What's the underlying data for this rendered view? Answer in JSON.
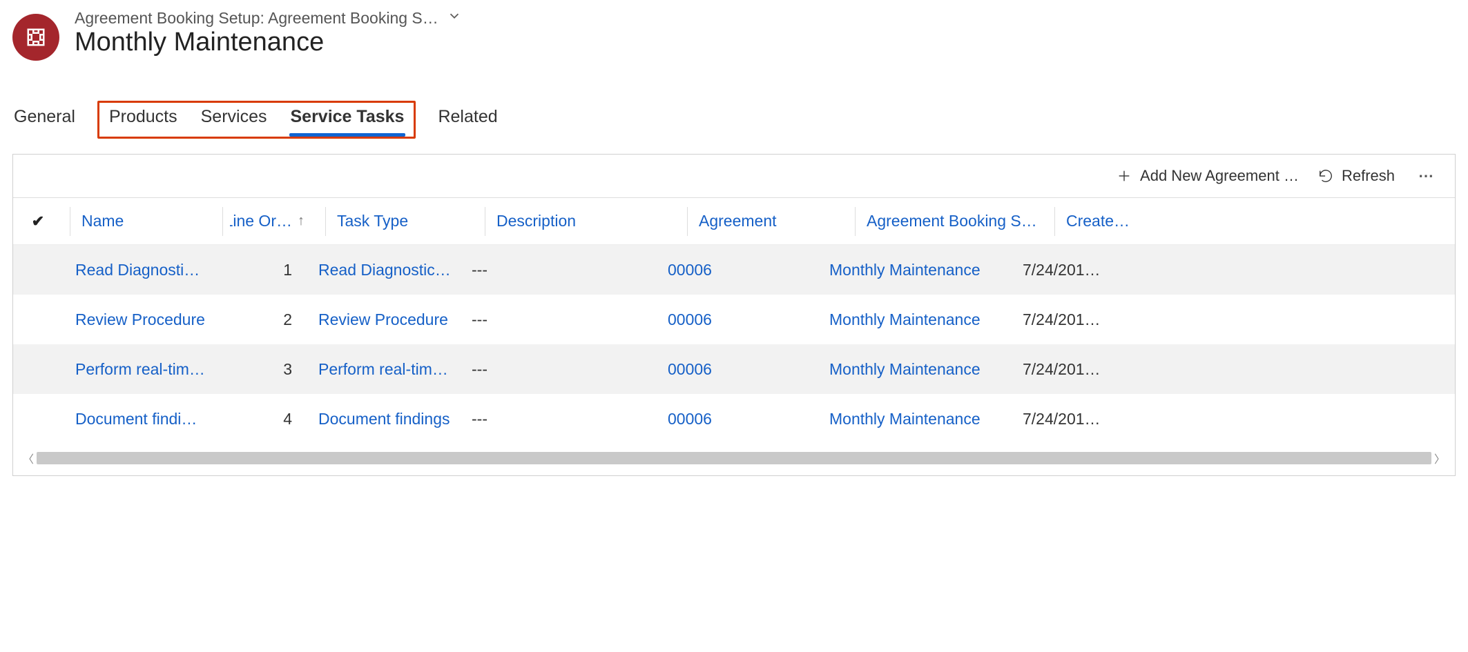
{
  "header": {
    "breadcrumb": "Agreement Booking Setup: Agreement Booking S…",
    "title": "Monthly Maintenance"
  },
  "tabs": {
    "general": "General",
    "products": "Products",
    "services": "Services",
    "service_tasks": "Service Tasks",
    "related": "Related"
  },
  "toolbar": {
    "add_new": "Add New Agreement …",
    "refresh": "Refresh"
  },
  "columns": {
    "name": "Name",
    "line_order": "Line Or…",
    "task_type": "Task Type",
    "description": "Description",
    "agreement": "Agreement",
    "abs": "Agreement Booking S…",
    "created": "Create…"
  },
  "rows": [
    {
      "name": "Read Diagnostic Codes",
      "line_order": "1",
      "task_type": "Read Diagnostic Codes",
      "description": "---",
      "agreement": "00006",
      "abs": "Monthly Maintenance",
      "created": "7/24/201…"
    },
    {
      "name": "Review Procedure",
      "line_order": "2",
      "task_type": "Review Procedure",
      "description": "---",
      "agreement": "00006",
      "abs": "Monthly Maintenance",
      "created": "7/24/201…"
    },
    {
      "name": "Perform real-time insp",
      "line_order": "3",
      "task_type": "Perform real-time insp",
      "description": "---",
      "agreement": "00006",
      "abs": "Monthly Maintenance",
      "created": "7/24/201…"
    },
    {
      "name": "Document findings",
      "line_order": "4",
      "task_type": "Document findings",
      "description": "---",
      "agreement": "00006",
      "abs": "Monthly Maintenance",
      "created": "7/24/201…"
    }
  ]
}
